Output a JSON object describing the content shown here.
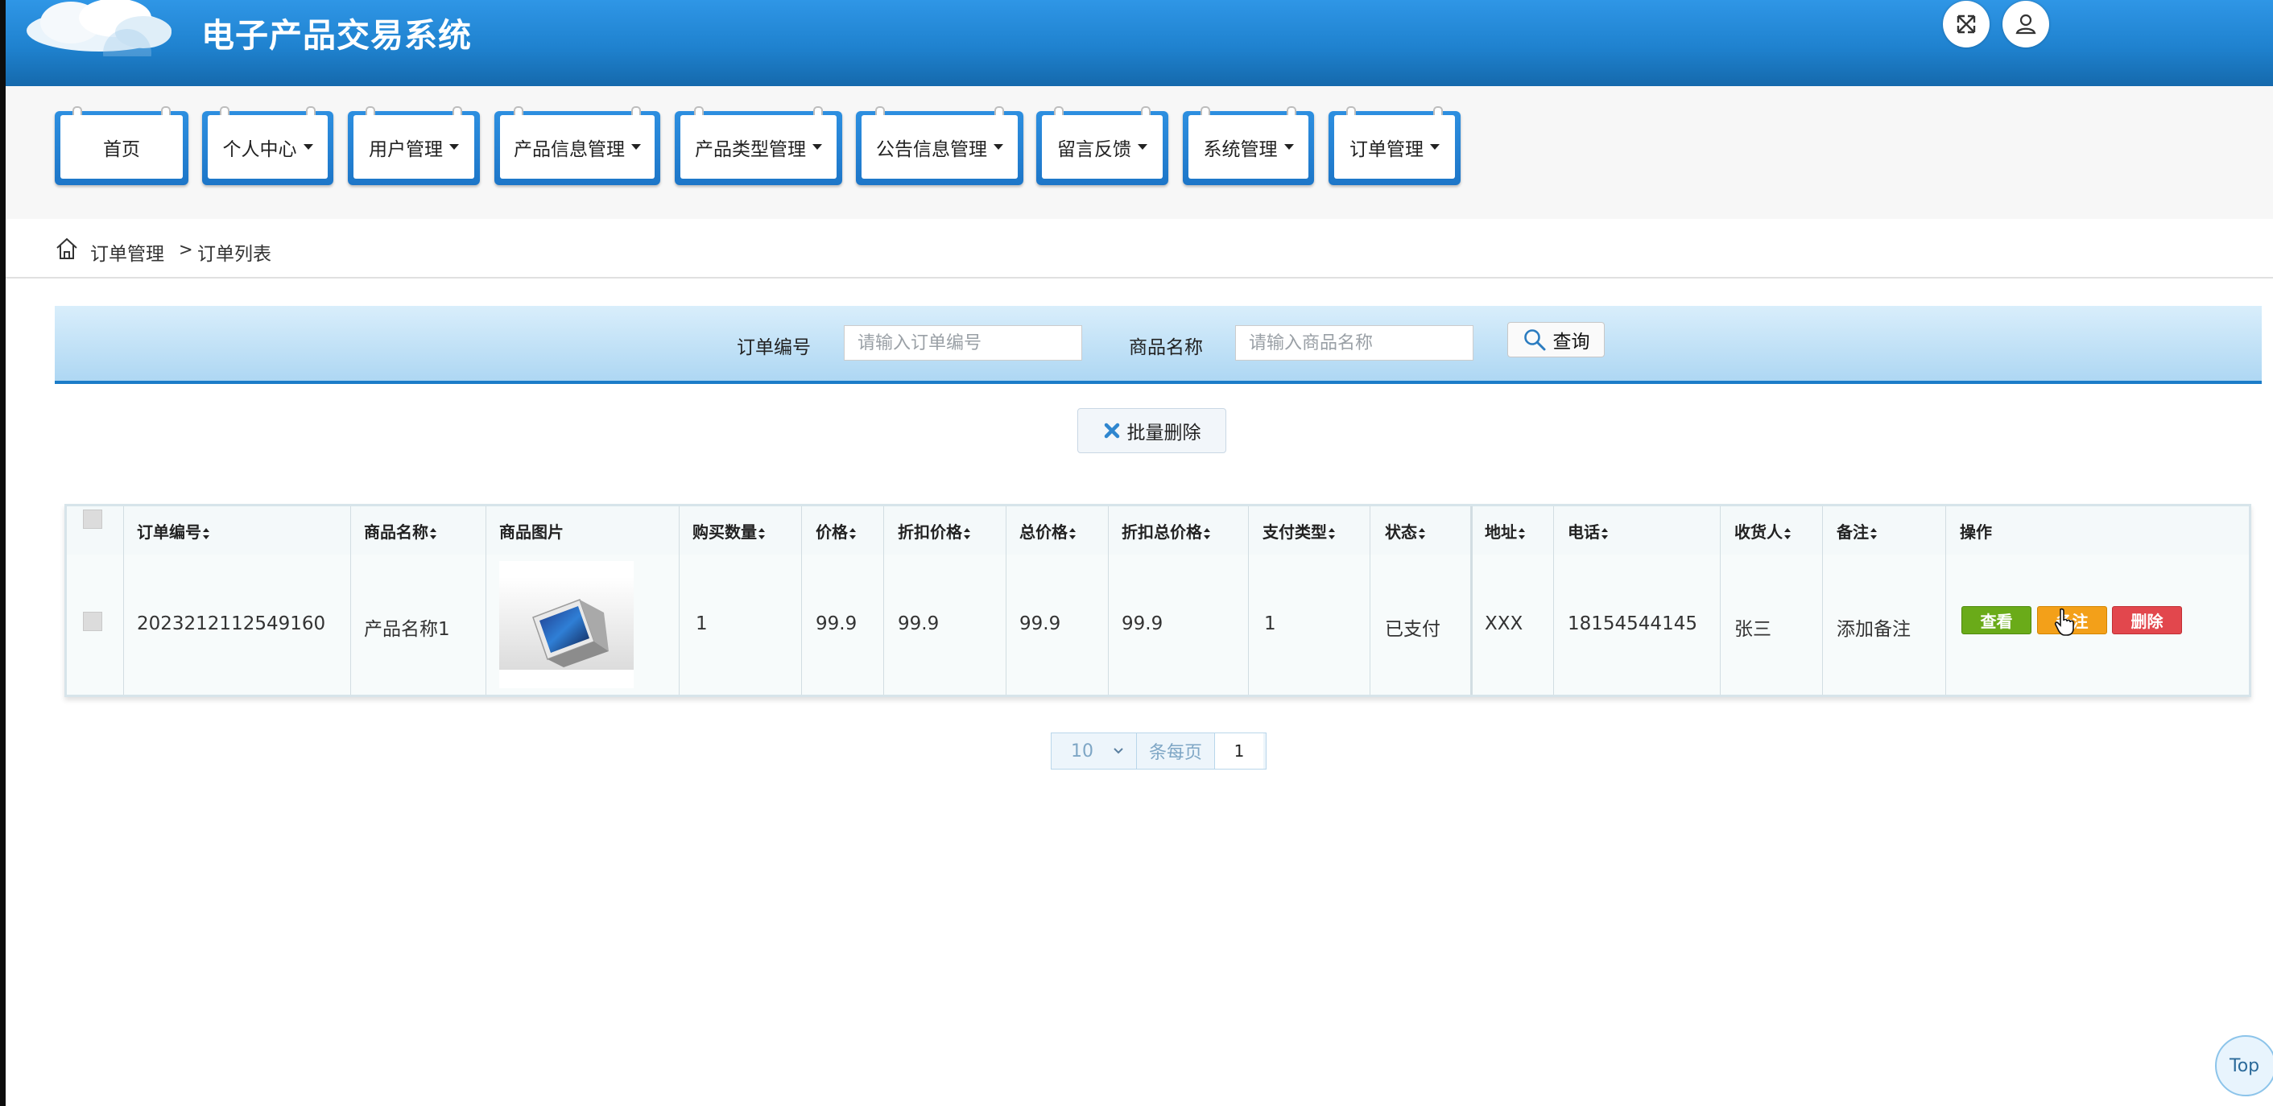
{
  "header": {
    "app_title": "电子产品交易系统"
  },
  "nav": {
    "items": [
      {
        "label": "首页",
        "has_dropdown": false
      },
      {
        "label": "个人中心",
        "has_dropdown": true
      },
      {
        "label": "用户管理",
        "has_dropdown": true
      },
      {
        "label": "产品信息管理",
        "has_dropdown": true
      },
      {
        "label": "产品类型管理",
        "has_dropdown": true
      },
      {
        "label": "公告信息管理",
        "has_dropdown": true
      },
      {
        "label": "留言反馈",
        "has_dropdown": true
      },
      {
        "label": "系统管理",
        "has_dropdown": true
      },
      {
        "label": "订单管理",
        "has_dropdown": true
      }
    ]
  },
  "breadcrumb": {
    "parent": "订单管理",
    "separator": ">",
    "current": "订单列表"
  },
  "search": {
    "order_no_label": "订单编号",
    "order_no_placeholder": "请输入订单编号",
    "product_name_label": "商品名称",
    "product_name_placeholder": "请输入商品名称",
    "query_label": "查询"
  },
  "batch_delete_label": "批量删除",
  "table": {
    "columns": [
      "订单编号",
      "商品名称",
      "商品图片",
      "购买数量",
      "价格",
      "折扣价格",
      "总价格",
      "折扣总价格",
      "支付类型",
      "状态",
      "地址",
      "电话",
      "收货人",
      "备注",
      "操作"
    ],
    "rows": [
      {
        "order_no": "2023212112549160",
        "product_name": "产品名称1",
        "quantity": "1",
        "price": "99.9",
        "discount_price": "99.9",
        "total_price": "99.9",
        "discount_total": "99.9",
        "pay_type": "1",
        "status": "已支付",
        "address": "XXX",
        "phone": "18154544145",
        "receiver": "张三",
        "remark": "添加备注"
      }
    ],
    "actions": {
      "view": "查看",
      "remark": "备注",
      "delete": "删除"
    }
  },
  "pagination": {
    "page_size": "10",
    "per_page_label": "条每页",
    "current_page": "1"
  },
  "top_button_label": "Top",
  "colors": {
    "header_blue": "#2f96e6",
    "view_green": "#6aab19",
    "remark_orange": "#f3a019",
    "delete_red": "#e2474d"
  }
}
